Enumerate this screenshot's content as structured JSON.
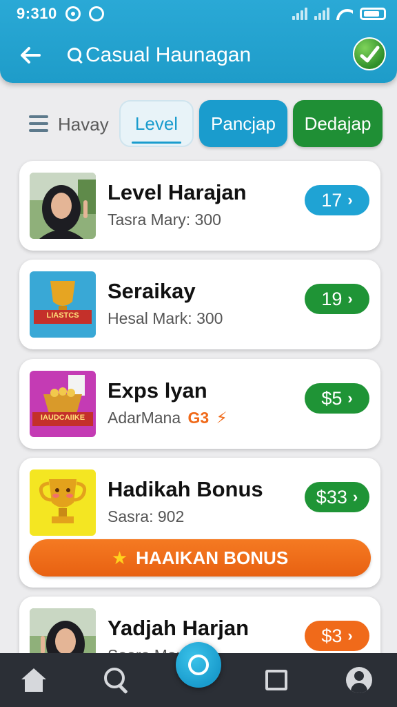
{
  "status_bar": {
    "time": "9:310"
  },
  "header": {
    "title": "Casual Haunagan"
  },
  "filters": {
    "label": "Havay",
    "chips": [
      "Level",
      "Pancjap",
      "Dedajap"
    ]
  },
  "cards": [
    {
      "title": "Level Harajan",
      "subtitle": "Tasra Mary: 300",
      "badge": "17",
      "badge_color": "#1fa3d4",
      "thumb": "woman-pointing-photo"
    },
    {
      "title": "Seraikay",
      "subtitle": "Hesal Mark: 300",
      "badge": "19",
      "badge_color": "#1f9436",
      "thumb": "trophy-cup-banner",
      "thumb_text": "LIASTCS"
    },
    {
      "title": "Exps lyan",
      "subtitle": "AdarMana",
      "subtitle_extra": "G3",
      "badge": "$5",
      "badge_color": "#1f9436",
      "thumb": "basket-banner",
      "thumb_text": "IAUDCAIIKE"
    },
    {
      "title": "Hadikah Bonus",
      "subtitle": "Sasra: 902",
      "badge": "$33",
      "badge_color": "#1f9436",
      "thumb": "golden-trophy-face",
      "action_label": "HAAIKAN BONUS"
    },
    {
      "title": "Yadjah Harjan",
      "subtitle": "Soara Mon:",
      "badge": "$3",
      "badge_color": "#f06a1a",
      "thumb": "woman-pointing-photo"
    }
  ],
  "bottom_nav": {
    "items": [
      "home-icon",
      "search-icon",
      "circle-icon",
      "square-icon",
      "user-icon"
    ]
  },
  "colors": {
    "primary": "#1e9cc9",
    "green": "#1f9436",
    "orange": "#f06a1a",
    "nav_bg": "#2b2f36"
  }
}
